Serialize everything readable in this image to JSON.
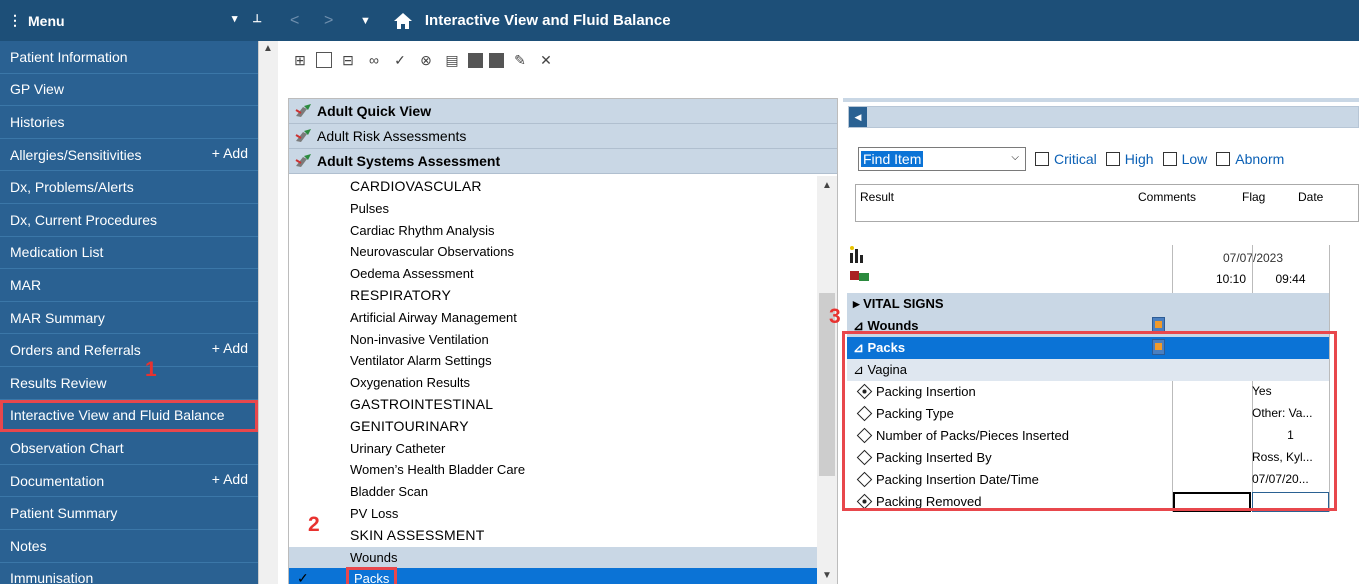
{
  "menu": {
    "title": "Menu",
    "items": [
      {
        "label": "Patient Information"
      },
      {
        "label": "GP View"
      },
      {
        "label": "Histories"
      },
      {
        "label": "Allergies/Sensitivities",
        "add": "Add"
      },
      {
        "label": "Dx, Problems/Alerts"
      },
      {
        "label": "Dx, Current Procedures"
      },
      {
        "label": "Medication List"
      },
      {
        "label": "MAR"
      },
      {
        "label": "MAR Summary"
      },
      {
        "label": "Orders and Referrals",
        "add": "Add"
      },
      {
        "label": "Results Review"
      },
      {
        "label": "Interactive View and Fluid Balance",
        "selected": true
      },
      {
        "label": "Observation Chart"
      },
      {
        "label": "Documentation",
        "add": "Add"
      },
      {
        "label": "Patient Summary"
      },
      {
        "label": "Notes"
      },
      {
        "label": "Immunisation"
      }
    ]
  },
  "titlebar": {
    "title": "Interactive View and Fluid Balance"
  },
  "bands": [
    "Adult Quick View",
    "Adult Risk Assessments",
    "Adult Systems Assessment"
  ],
  "sections": [
    {
      "label": "CARDIOVASCULAR",
      "cap": true
    },
    {
      "label": "Pulses"
    },
    {
      "label": "Cardiac Rhythm Analysis"
    },
    {
      "label": "Neurovascular Observations"
    },
    {
      "label": "Oedema Assessment"
    },
    {
      "label": "RESPIRATORY",
      "cap": true
    },
    {
      "label": "Artificial Airway Management"
    },
    {
      "label": "Non-invasive Ventilation"
    },
    {
      "label": "Ventilator Alarm Settings"
    },
    {
      "label": "Oxygenation Results"
    },
    {
      "label": "GASTROINTESTINAL",
      "cap": true
    },
    {
      "label": "GENITOURINARY",
      "cap": true
    },
    {
      "label": "Urinary Catheter"
    },
    {
      "label": "Women’s Health Bladder Care"
    },
    {
      "label": "Bladder Scan"
    },
    {
      "label": "PV Loss"
    },
    {
      "label": "SKIN ASSESSMENT",
      "cap": true
    },
    {
      "label": "Wounds",
      "hl": true
    },
    {
      "label": "Packs",
      "selected": true
    }
  ],
  "find": {
    "value": "Find Item",
    "filters": [
      "Critical",
      "High",
      "Low",
      "Abnorm"
    ]
  },
  "result_grid": {
    "columns": [
      "Result",
      "Comments",
      "Flag",
      "Date"
    ]
  },
  "flowsheet": {
    "date": "07/07/2023",
    "times": [
      "10:10",
      "09:44"
    ],
    "rows": [
      {
        "label": "▸ VITAL SIGNS",
        "type": "grp"
      },
      {
        "label": "⊿ Wounds",
        "type": "grp",
        "doc": true
      },
      {
        "label": "⊿ Packs",
        "type": "selgrp",
        "doc": true
      },
      {
        "label": "⊿ Vagina",
        "type": "sub"
      },
      {
        "label": "Packing Insertion",
        "marker": "fill",
        "v": "Yes"
      },
      {
        "label": "Packing Type",
        "marker": "empty",
        "v": "Other: Va..."
      },
      {
        "label": "Number of Packs/Pieces Inserted",
        "marker": "empty",
        "v": "1"
      },
      {
        "label": "Packing Inserted By",
        "marker": "empty",
        "v": "Ross, Kyl..."
      },
      {
        "label": "Packing Insertion Date/Time",
        "marker": "empty",
        "v": "07/07/20..."
      },
      {
        "label": "Packing Removed",
        "marker": "fill",
        "v": ""
      }
    ]
  },
  "callouts": [
    "1",
    "2",
    "3"
  ],
  "colors": {
    "nav_dark": "#1d4f78",
    "nav": "#2a6192",
    "highlight": "#e8474c",
    "select": "#0b73d6"
  }
}
